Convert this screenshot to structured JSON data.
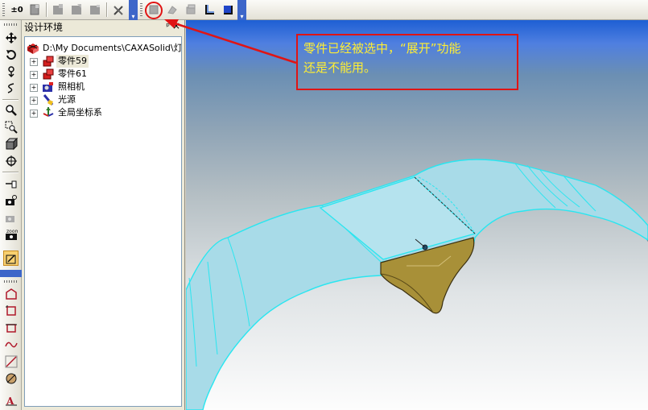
{
  "panel": {
    "title": "设计环境",
    "pin_glyph": "ᵖ",
    "close_glyph": "×"
  },
  "tree": {
    "root": "D:\\My Documents\\CAXASolid\\灯",
    "items": [
      {
        "label": "零件59",
        "icon": "part-icon",
        "selected": true
      },
      {
        "label": "零件61",
        "icon": "part-icon",
        "selected": false
      },
      {
        "label": "照相机",
        "icon": "camera-icon",
        "selected": false
      },
      {
        "label": "光源",
        "icon": "light-icon",
        "selected": false
      },
      {
        "label": "全局坐标系",
        "icon": "axes-icon",
        "selected": false
      }
    ],
    "expander_glyph": "+"
  },
  "toolbar": {
    "first_label": "±0",
    "icons": [
      "new-icon",
      "part-a-icon",
      "part-b-icon",
      "part-c-icon",
      "tools-icon",
      "unfold-icon",
      "fold-icon",
      "box-icon",
      "bend-l-icon",
      "bend-flange-icon"
    ]
  },
  "callout": {
    "line1": "零件已经被选中，“展开”功能",
    "line2": "还是不能用。"
  },
  "colors": {
    "annotation_red": "#e01414",
    "annotation_text": "#ffee33",
    "surface_fill": "#a8dbe8",
    "surface_edge": "#29e6f0",
    "flange_fill": "#a89038"
  }
}
